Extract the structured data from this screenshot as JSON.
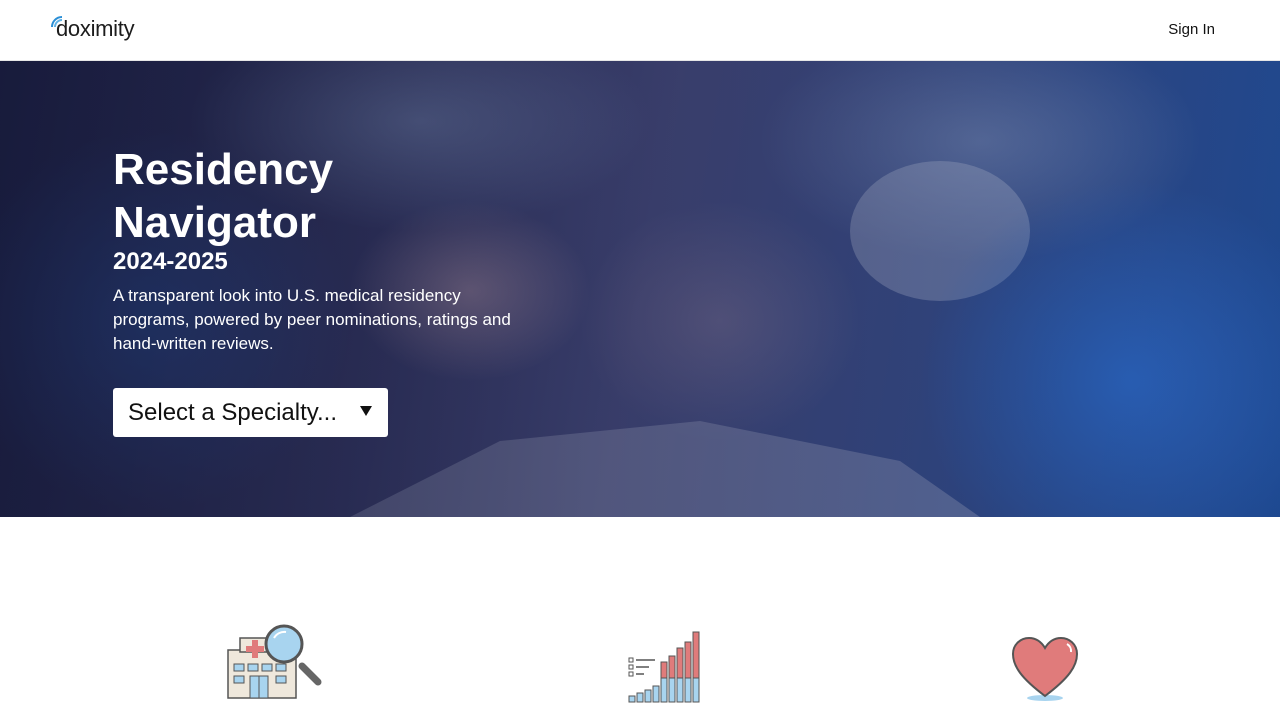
{
  "header": {
    "brand": "doximity",
    "sign_in_label": "Sign In"
  },
  "hero": {
    "title": "Residency Navigator",
    "years": "2024-2025",
    "description": "A transparent look into U.S. medical residency programs, powered by peer nominations, ratings and hand-written reviews.",
    "specialty_select": {
      "placeholder": "Select a Specialty..."
    }
  },
  "features": {
    "icons": [
      "hospital-search-icon",
      "ranking-bars-icon",
      "heart-icon"
    ]
  },
  "colors": {
    "brand_blue": "#2b8fd6",
    "hero_overlay": "#2a2f66",
    "icon_red": "#e07b7b",
    "icon_blue": "#a8d4ef"
  }
}
